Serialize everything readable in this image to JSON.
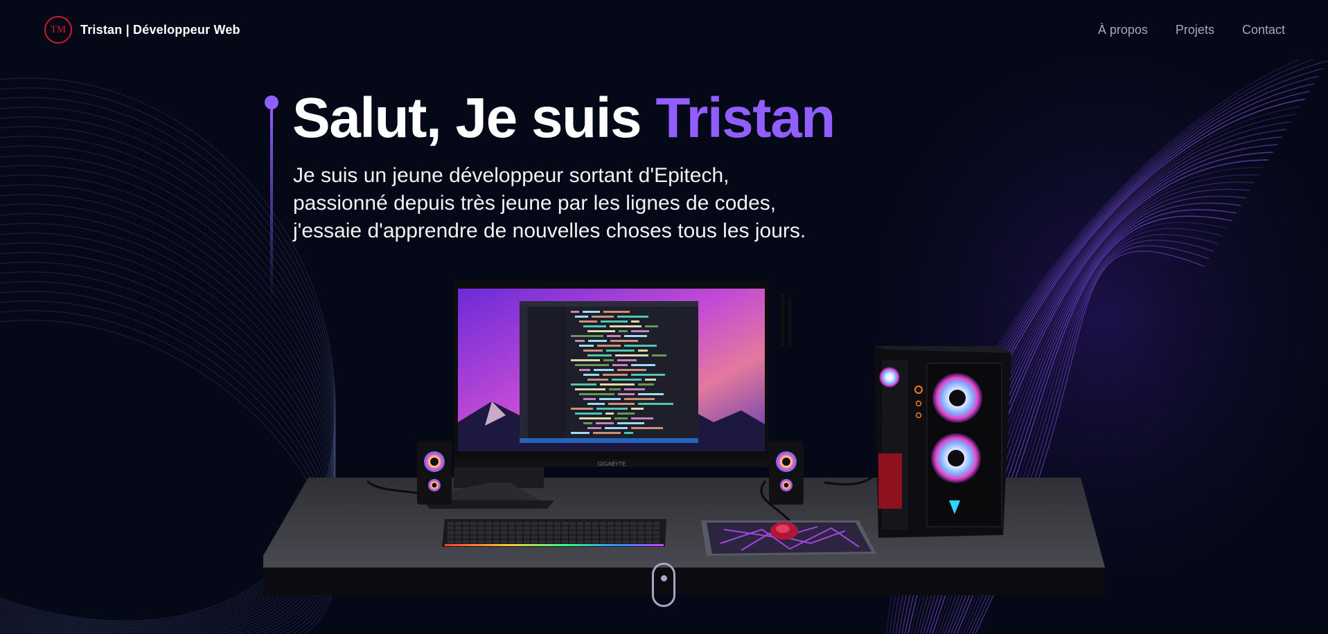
{
  "nav": {
    "logo_text": "TM",
    "brand": "Tristan | Développeur Web",
    "links": [
      "À propos",
      "Projets",
      "Contact"
    ]
  },
  "hero": {
    "title_prefix": "Salut, Je suis ",
    "title_name": "Tristan",
    "subtitle_lines": [
      "Je suis un jeune développeur sortant d'Epitech,",
      "passionné depuis très jeune par les lignes de codes,",
      "j'essaie d'apprendre de nouvelles choses tous les jours."
    ]
  },
  "scene": {
    "monitor_brand": "GIGABYTE"
  },
  "colors": {
    "background": "#050816",
    "accent": "#915eff",
    "nav_text": "#aaa6c3",
    "logo_red": "#d11a2a"
  }
}
